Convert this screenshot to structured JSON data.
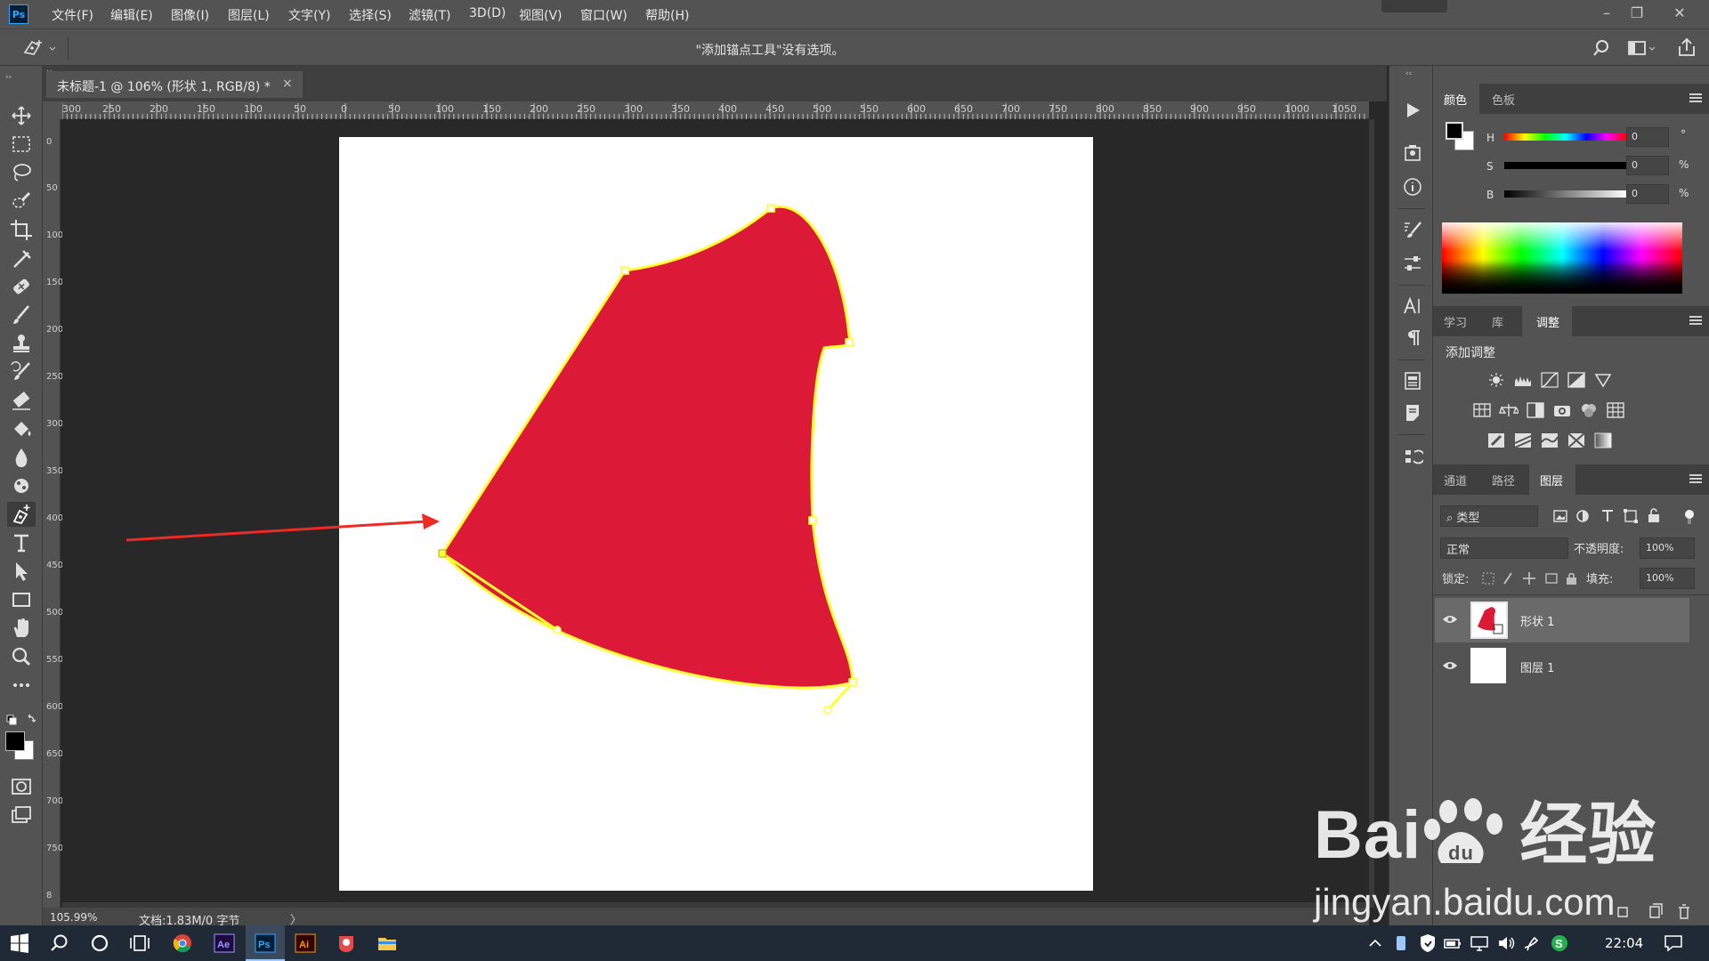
{
  "app": {
    "logo": "Ps"
  },
  "menu": [
    "文件(F)",
    "编辑(E)",
    "图像(I)",
    "图层(L)",
    "文字(Y)",
    "选择(S)",
    "滤镜(T)",
    "3D(D)",
    "视图(V)",
    "窗口(W)",
    "帮助(H)"
  ],
  "window_controls": {
    "minimize": "–",
    "restore": "❐",
    "close": "✕"
  },
  "options_bar": {
    "message": "\"添加锚点工具\"没有选项。"
  },
  "document": {
    "tab_title": "未标题-1 @ 106% (形状 1, RGB/8) *",
    "close": "×",
    "ruler_top": [
      "300",
      "250",
      "200",
      "150",
      "100",
      "50",
      "0",
      "50",
      "100",
      "150",
      "200",
      "250",
      "300",
      "350",
      "400",
      "450",
      "500",
      "550",
      "600",
      "650",
      "700",
      "750",
      "800",
      "850",
      "900",
      "950",
      "1000",
      "1050"
    ],
    "ruler_left": [
      "0",
      "50",
      "100",
      "150",
      "200",
      "250",
      "300",
      "350",
      "400",
      "450",
      "500",
      "550",
      "600",
      "650",
      "700",
      "750",
      "8"
    ],
    "shape_color": "#dc1a38",
    "path_color": "#ffff33",
    "arrow_color": "#ee2a24"
  },
  "status": {
    "zoom": "105.99%",
    "doc_info": "文档:1.83M/0 字节",
    "arrow": "〉"
  },
  "color_panel": {
    "tabs": [
      "颜色",
      "色板"
    ],
    "active_tab": 0,
    "sliders": [
      {
        "label": "H",
        "value": "0",
        "unit": "°"
      },
      {
        "label": "S",
        "value": "0",
        "unit": "%"
      },
      {
        "label": "B",
        "value": "0",
        "unit": "%"
      }
    ]
  },
  "adjust_panel": {
    "tabs": [
      "学习",
      "库",
      "调整"
    ],
    "active_tab": 2,
    "heading": "添加调整"
  },
  "layers_panel": {
    "tabs": [
      "通道",
      "路径",
      "图层"
    ],
    "active_tab": 2,
    "filter": "类型",
    "blend_mode": "正常",
    "opacity_label": "不透明度:",
    "opacity": "100%",
    "lock_label": "锁定:",
    "fill_label": "填充:",
    "fill": "100%",
    "layers": [
      {
        "name": "形状 1",
        "selected": true
      },
      {
        "name": "图层 1",
        "selected": false
      }
    ]
  },
  "taskbar": {
    "clock": "22:04"
  },
  "watermark": {
    "brand": "Bai",
    "brand2": "经验",
    "url": "jingyan.baidu.com"
  }
}
